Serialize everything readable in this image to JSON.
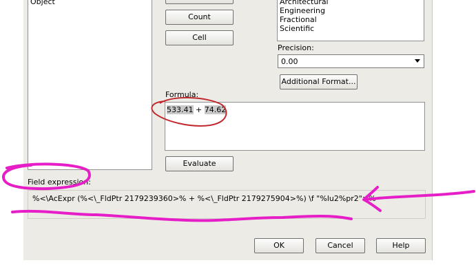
{
  "left_list": {
    "items": [
      "Object"
    ]
  },
  "buttons": {
    "count": "Count",
    "cell": "Cell",
    "evaluate": "Evaluate",
    "additional_format": "Additional Format...",
    "ok": "OK",
    "cancel": "Cancel",
    "help": "Help"
  },
  "format_list": {
    "items": [
      "Architectural",
      "Engineering",
      "Fractional",
      "Scientific"
    ]
  },
  "precision": {
    "label": "Precision:",
    "value": "0.00"
  },
  "formula": {
    "label": "Formula:",
    "operand1": "533.41",
    "operator": " + ",
    "operand2": "74.62"
  },
  "field_expression": {
    "label": "Field expression:",
    "value": "%<\\AcExpr (%<\\_FldPtr 2179239360>% + %<\\_FldPtr 2179275904>%) \\f \"%lu2%pr2\">%"
  },
  "annotations": {
    "color": "#e61ec8",
    "formula_circle_color": "#c0282e"
  }
}
